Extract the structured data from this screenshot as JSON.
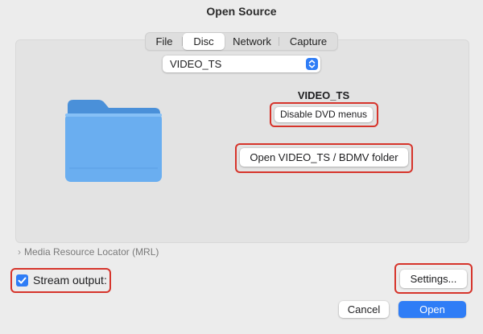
{
  "window": {
    "title": "Open Source"
  },
  "tabs": [
    {
      "label": "File",
      "active": false
    },
    {
      "label": "Disc",
      "active": true
    },
    {
      "label": "Network",
      "active": false
    },
    {
      "label": "Capture",
      "active": false
    }
  ],
  "disc_select": {
    "value": "VIDEO_TS"
  },
  "disc_info": {
    "name": "VIDEO_TS",
    "disable_menus_label": "Disable DVD menus",
    "open_folder_label": "Open VIDEO_TS / BDMV folder"
  },
  "mrl": {
    "label": "Media Resource Locator (MRL)"
  },
  "stream_output": {
    "label": "Stream output:",
    "checked": true
  },
  "settings": {
    "label": "Settings..."
  },
  "footer": {
    "cancel_label": "Cancel",
    "open_label": "Open"
  },
  "colors": {
    "accent": "#2f7df6",
    "highlight": "#d6342b",
    "folder": "#6aaef0"
  }
}
